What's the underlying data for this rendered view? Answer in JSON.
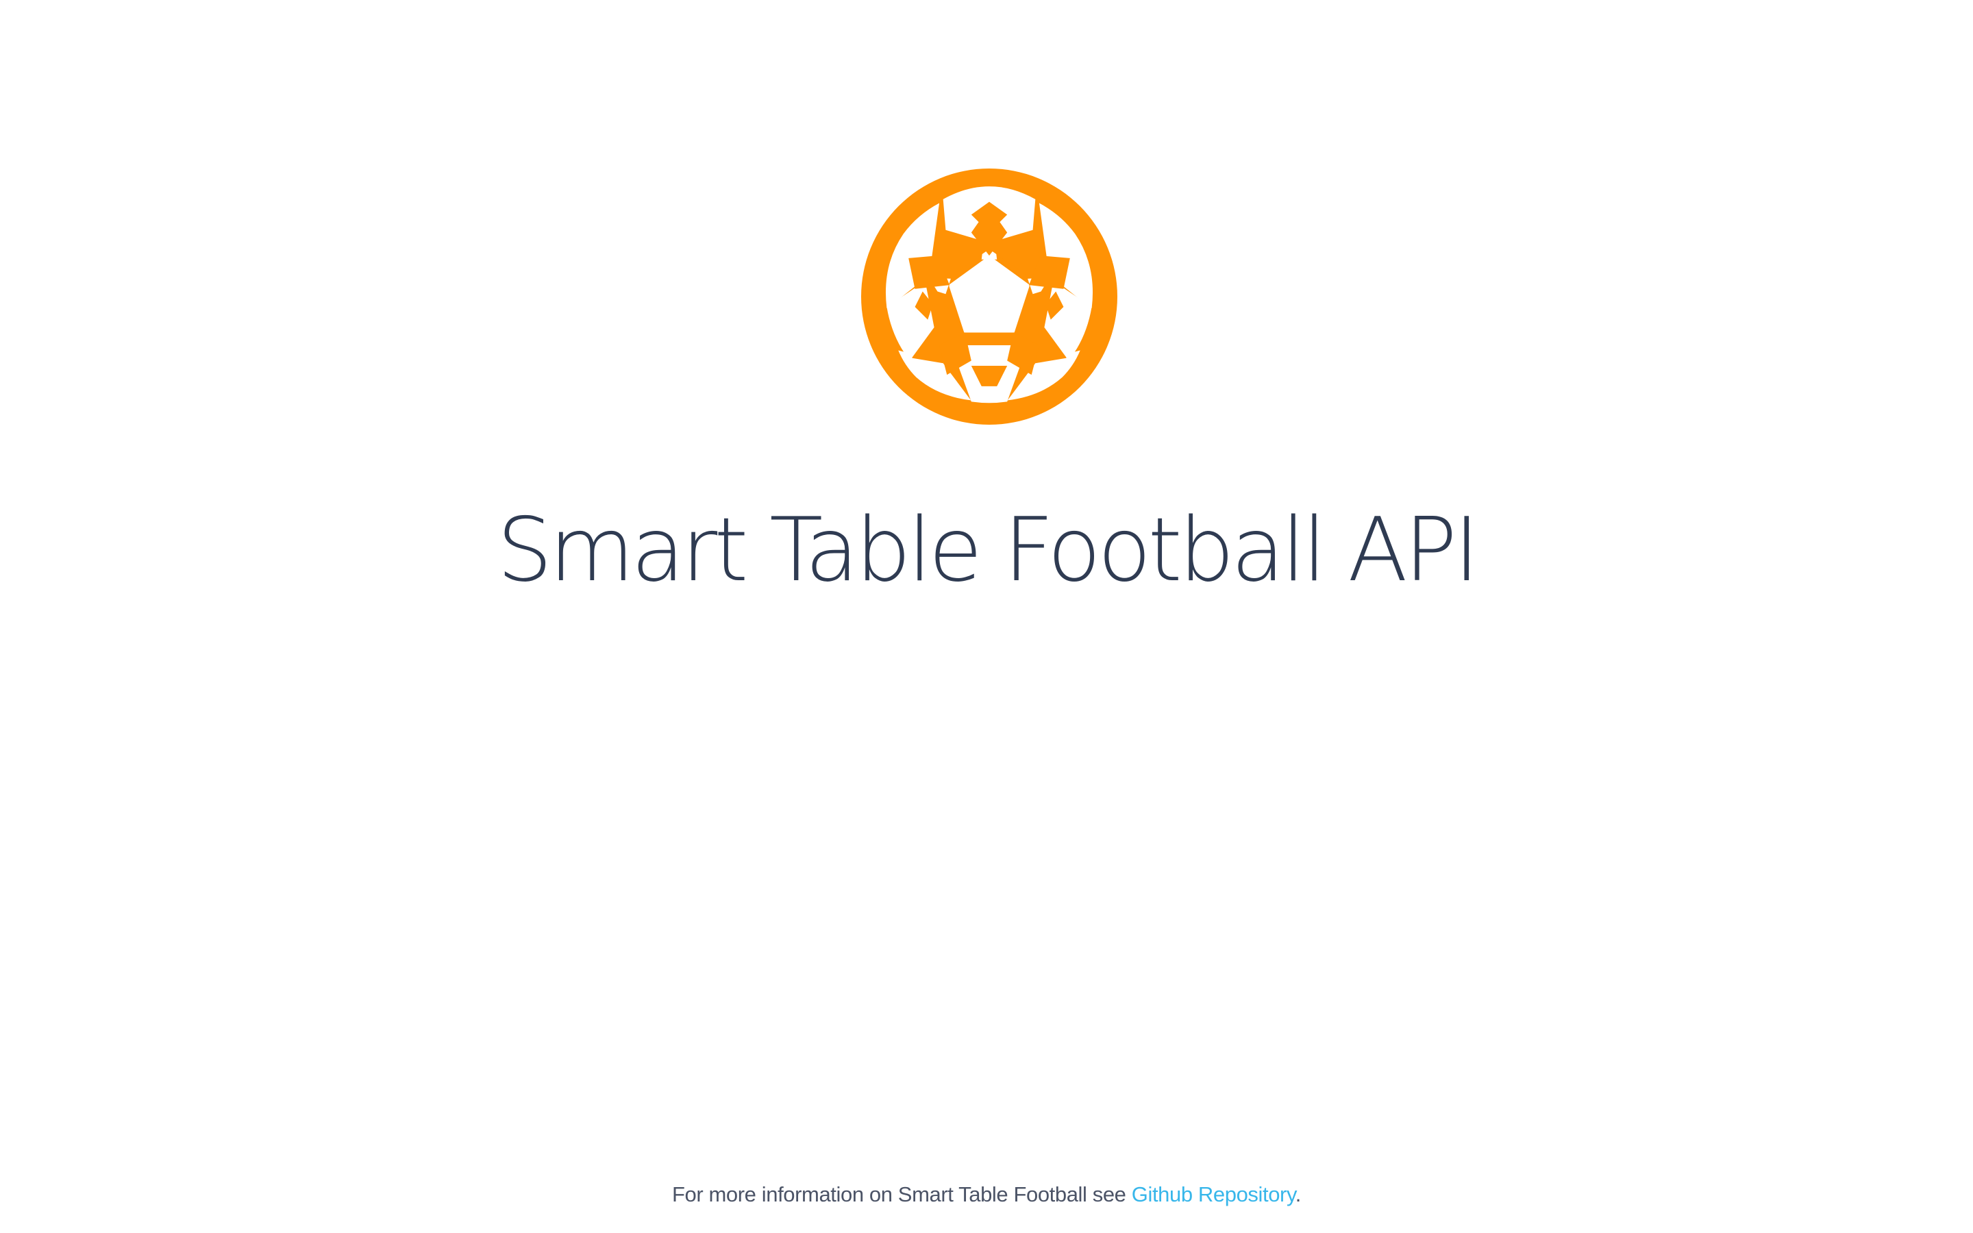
{
  "logo": {
    "icon": "soccer-ball-icon",
    "color": "#ff9205"
  },
  "title": "Smart Table Football API",
  "footer": {
    "prefix": "For more information on Smart Table Football see ",
    "link_text": "Github Repository",
    "suffix": "."
  },
  "colors": {
    "title": "#2f3b52",
    "text": "#4b5366",
    "link": "#37b6ea",
    "background": "#ffffff"
  }
}
